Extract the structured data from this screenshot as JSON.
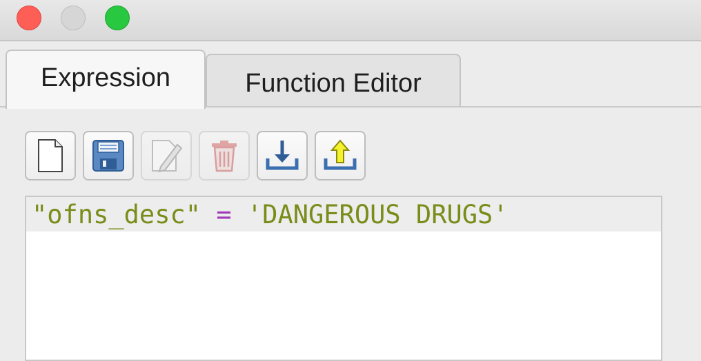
{
  "window": {
    "traffic_lights": [
      "close",
      "minimize",
      "zoom"
    ]
  },
  "tabs": [
    {
      "label": "Expression",
      "active": true
    },
    {
      "label": "Function Editor",
      "active": false
    }
  ],
  "toolbar": {
    "buttons": [
      {
        "icon": "new-file-icon",
        "enabled": true
      },
      {
        "icon": "save-icon",
        "enabled": true
      },
      {
        "icon": "edit-icon",
        "enabled": false
      },
      {
        "icon": "delete-icon",
        "enabled": false
      },
      {
        "icon": "import-icon",
        "enabled": true
      },
      {
        "icon": "export-icon",
        "enabled": true
      }
    ]
  },
  "editor": {
    "field": "\"ofns_desc\"",
    "operator": "=",
    "value": "'DANGEROUS DRUGS'"
  },
  "colors": {
    "field": "#7a8c1a",
    "operator": "#a03ab7",
    "string": "#7a8c1a"
  }
}
